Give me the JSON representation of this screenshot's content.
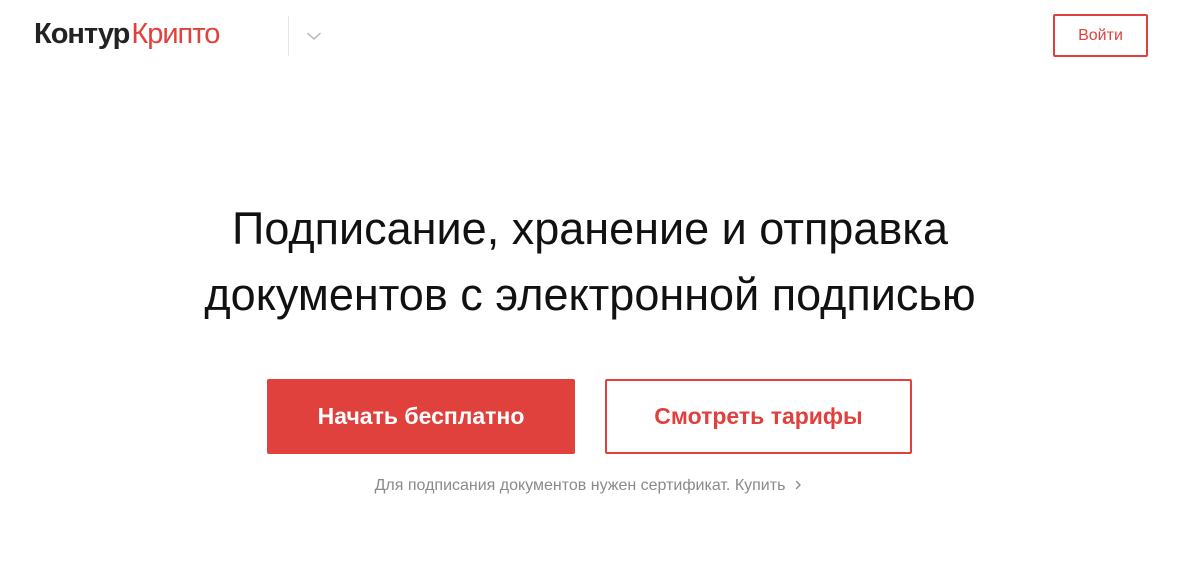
{
  "header": {
    "logo_main": "Контур",
    "logo_accent": "Крипто",
    "product_switch_icon": "chevron-down-icon",
    "login_label": "Войти"
  },
  "hero": {
    "title_line1": "Подписание, хранение и отправка",
    "title_line2": "документов с электронной подписью",
    "primary_cta": "Начать бесплатно",
    "secondary_cta": "Смотреть тарифы",
    "note_text": "Для подписания документов нужен сертификат.",
    "note_link": "Купить",
    "note_link_icon": "chevron-right-icon"
  },
  "colors": {
    "accent": "#e0413d",
    "text": "#111111",
    "muted": "#8a8a8a",
    "background": "#ffffff"
  }
}
